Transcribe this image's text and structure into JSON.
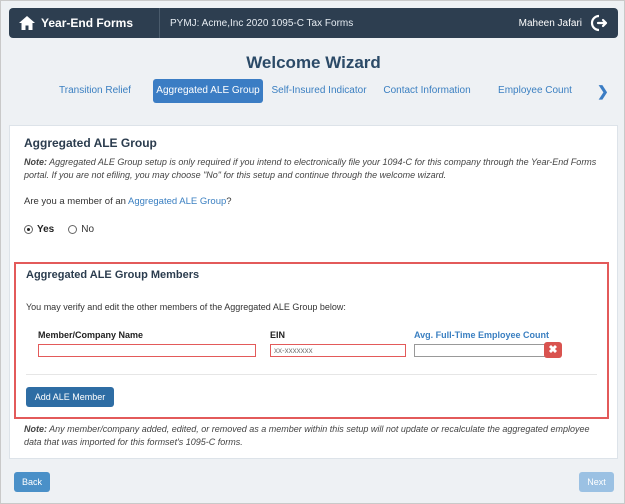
{
  "header": {
    "brand": "Year-End Forms",
    "context": "PYMJ: Acme,Inc 2020 1095-C Tax Forms",
    "user": "Maheen Jafari"
  },
  "wizard": {
    "title": "Welcome Wizard",
    "tabs": [
      {
        "label": "Transition Relief",
        "active": false
      },
      {
        "label": "Aggregated ALE Group",
        "active": true
      },
      {
        "label": "Self-Insured Indicator",
        "active": false
      },
      {
        "label": "Contact Information",
        "active": false
      },
      {
        "label": "Employee Count",
        "active": false
      }
    ]
  },
  "section": {
    "title": "Aggregated ALE Group",
    "note_label": "Note:",
    "note_text": "Aggregated ALE Group setup is only required if you intend to electronically file your 1094-C for this company through the Year-End Forms portal. If you are not efiling, you may choose \"No\" for this setup and continue through the welcome wizard.",
    "question_prefix": "Are you a member of an ",
    "question_link": "Aggregated ALE Group",
    "question_suffix": "?",
    "options": {
      "yes": "Yes",
      "no": "No",
      "selected": "yes"
    }
  },
  "members": {
    "title": "Aggregated ALE Group Members",
    "description": "You may verify and edit the other members of the Aggregated ALE Group below:",
    "columns": {
      "name": "Member/Company Name",
      "ein": "EIN",
      "count": "Avg. Full-Time Employee Count"
    },
    "row": {
      "name_value": "",
      "ein_placeholder": "xx-xxxxxxx",
      "count_value": ""
    },
    "delete_glyph": "✖",
    "add_label": "Add ALE Member"
  },
  "footer_note": {
    "label": "Note:",
    "text": "Any member/company added, edited, or removed as a member within this setup will not update or recalculate the aggregated employee data that was imported for this formset's 1095-C forms."
  },
  "nav": {
    "back": "Back",
    "next": "Next"
  },
  "colors": {
    "header_bg": "#2d3e50",
    "accent": "#3b7dc4",
    "error": "#e35a5a",
    "primary_button": "#2e6da4"
  }
}
